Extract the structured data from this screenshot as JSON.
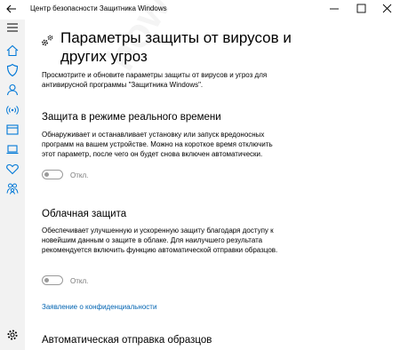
{
  "window": {
    "title": "Центр безопасности Защитника Windows"
  },
  "sidebar": {
    "items": [
      {
        "icon": "hamburger-menu-icon"
      },
      {
        "icon": "home-icon"
      },
      {
        "icon": "shield-icon"
      },
      {
        "icon": "person-icon"
      },
      {
        "icon": "wireless-icon"
      },
      {
        "icon": "browser-window-icon"
      },
      {
        "icon": "laptop-icon"
      },
      {
        "icon": "heart-icon"
      },
      {
        "icon": "family-icon"
      },
      {
        "icon": "settings-gear-icon"
      }
    ]
  },
  "page": {
    "title": "Параметры защиты от вирусов и других угроз",
    "intro": "Просмотрите и обновите параметры защиты от вирусов и угроз для антивирусной программы \"Защитника Windows\"."
  },
  "realtime": {
    "title": "Защита в режиме реального времени",
    "description": "Обнаруживает и останавливает установку или запуск вредоносных программ на вашем устройстве. Можно на короткое время отключить этот параметр, после чего он будет снова включен автоматически.",
    "state_label": "Откл.",
    "enabled": false
  },
  "cloud": {
    "title": "Облачная защита",
    "description": "Обеспечивает улучшенную и ускоренную защиту благодаря доступу к новейшим данным о защите в облаке. Для наилучшего результата рекомендуется включить функцию автоматической отправки образцов.",
    "state_label": "Откл.",
    "enabled": false
  },
  "privacy_link": "Заявление о конфиденциальности",
  "auto_submit": {
    "title": "Автоматическая отправка образцов"
  },
  "watermark": "howto-wiki.ru",
  "colors": {
    "accent": "#0078d7",
    "link": "#0063b1",
    "sidebar_bg": "#f2f2f2",
    "toggle_off": "#9a9a9a"
  }
}
